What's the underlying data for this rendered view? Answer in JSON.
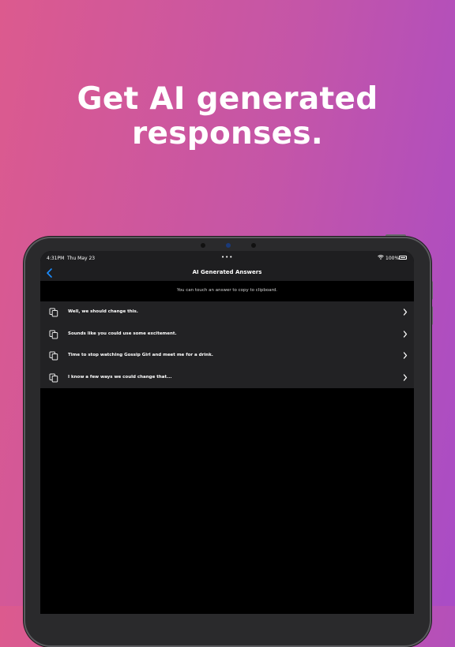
{
  "headline": {
    "line1": "Get AI generated",
    "line2": "responses."
  },
  "status_bar": {
    "time": "4:31PM",
    "date": "Thu May 23",
    "dots": "•••",
    "battery_text": "100%"
  },
  "nav": {
    "title": "AI Generated Answers",
    "back_icon": "chevron-left-icon"
  },
  "hint": "You can touch an answer to copy to clipboard.",
  "answers": [
    {
      "text": "Well, we should change this."
    },
    {
      "text": "Sounds like you could use some excitement."
    },
    {
      "text": "Time to stop watching Gossip Girl and meet me for a drink."
    },
    {
      "text": "I know a few ways we could change that..."
    }
  ],
  "colors": {
    "gradient_left": "#dc5a8e",
    "gradient_right": "#a94cc6",
    "accent_blue": "#1a8cff",
    "row_background": "#222224"
  }
}
